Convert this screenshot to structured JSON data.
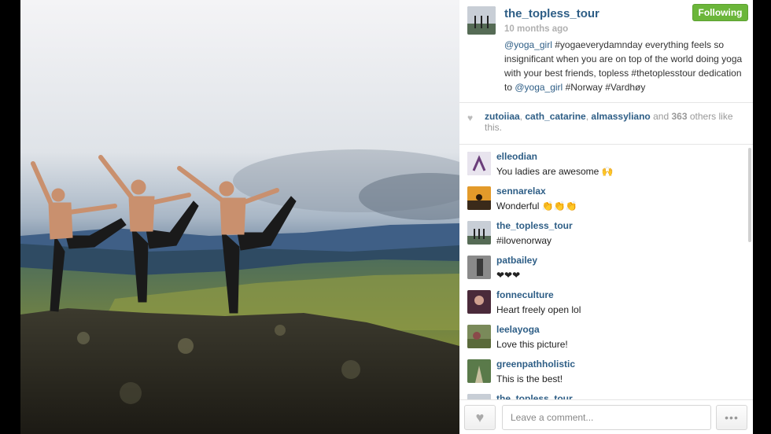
{
  "post": {
    "username": "the_topless_tour",
    "follow_label": "Following",
    "time": "10 months ago",
    "caption": [
      {
        "text": "@yoga_girl",
        "link": true
      },
      {
        "text": " #yogaeverydamnday everything feels so insignificant when you are on top of the world doing yoga with your best friends, topless #thetoplesstour dedication to ",
        "link": false
      },
      {
        "text": "@yoga_girl",
        "link": true
      },
      {
        "text": " #Norway #Vardhøy",
        "link": false
      }
    ]
  },
  "likes": {
    "user1": "zutoiiaa",
    "sep1": ", ",
    "user2": "cath_catarine",
    "sep2": ", ",
    "user3": "almassyliano",
    "and": " and ",
    "count": "363",
    "suffix": " others like this."
  },
  "comments": [
    {
      "user": "elleodian",
      "text": "You ladies are awesome 🙌"
    },
    {
      "user": "sennarelax",
      "text": "Wonderful 👏👏👏"
    },
    {
      "user": "the_topless_tour",
      "text": "#ilovenorway"
    },
    {
      "user": "patbailey",
      "text": "❤❤❤"
    },
    {
      "user": "fonneculture",
      "text": "Heart freely open lol"
    },
    {
      "user": "leelayoga",
      "text": "Love this picture!"
    },
    {
      "user": "greenpathholistic",
      "text": "This is the best!"
    },
    {
      "user": "the_topless_tour",
      "text": ""
    }
  ],
  "footer": {
    "comment_placeholder": "Leave a comment...",
    "like_icon": "heart-icon",
    "more_icon": "ellipsis-icon",
    "more_label": "•••"
  },
  "colors": {
    "link": "#2e5e86",
    "follow": "#6bb63a"
  }
}
